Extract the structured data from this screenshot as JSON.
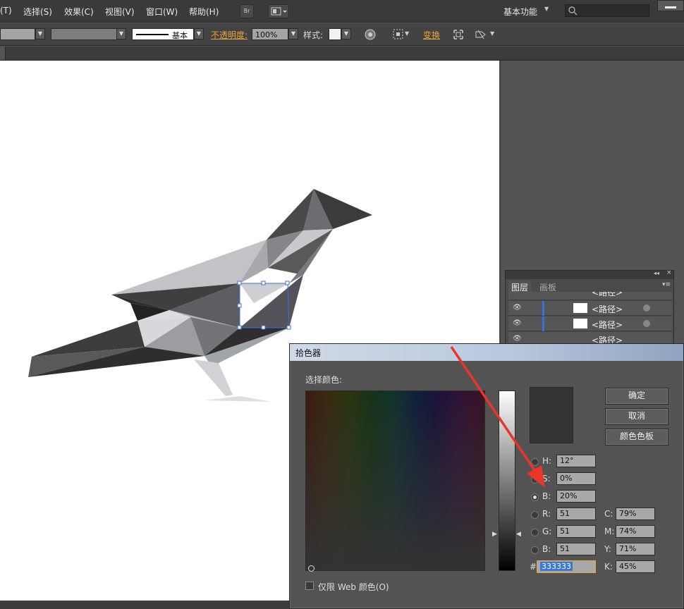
{
  "menu": {
    "items": [
      "(T)",
      "选择(S)",
      "效果(C)",
      "视图(V)",
      "窗口(W)",
      "帮助(H)"
    ],
    "bridge_label": "Br",
    "workspace": "基本功能"
  },
  "control": {
    "stroke_style": "基本",
    "opacity_label": "不透明度:",
    "opacity_value": "100%",
    "style_label": "样式:",
    "transform_label": "变换"
  },
  "layers_panel": {
    "tabs": [
      "图层",
      "画板"
    ],
    "rows": [
      "<路径>",
      "<路径>",
      "<路径>",
      "<路径>"
    ]
  },
  "color_picker": {
    "title": "拾色器",
    "select_label": "选择颜色:",
    "buttons": {
      "ok": "确定",
      "cancel": "取消",
      "swatches": "颜色色板"
    },
    "hsb": [
      {
        "label": "H:",
        "value": "12°",
        "selected": false
      },
      {
        "label": "S:",
        "value": "0%",
        "selected": false
      },
      {
        "label": "B:",
        "value": "20%",
        "selected": true
      }
    ],
    "rgb": [
      {
        "label": "R:",
        "value": "51"
      },
      {
        "label": "G:",
        "value": "51"
      },
      {
        "label": "B:",
        "value": "51"
      }
    ],
    "cmyk": [
      {
        "label": "C:",
        "value": "79%"
      },
      {
        "label": "M:",
        "value": "74%"
      },
      {
        "label": "Y:",
        "value": "71%"
      },
      {
        "label": "K:",
        "value": "45%"
      }
    ],
    "hex_label": "#",
    "hex_value": "333333",
    "web_only_label": "仅限 Web 颜色(O)",
    "current_color": "#333333"
  },
  "colors": {
    "annotation_arrow": "#e8362b",
    "selection": "#3b6fd6"
  }
}
